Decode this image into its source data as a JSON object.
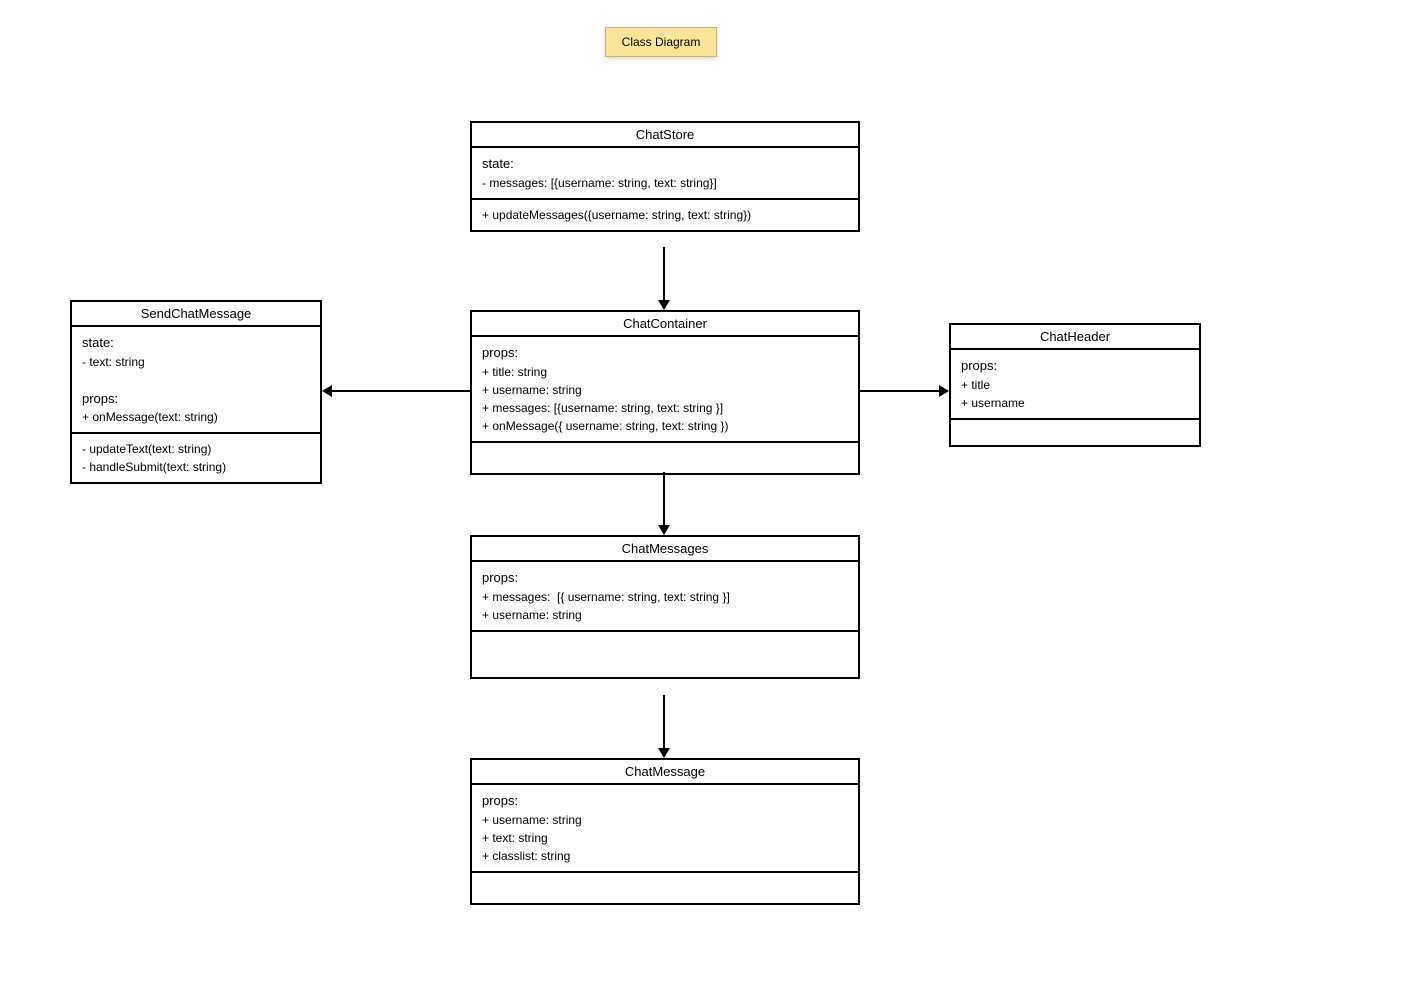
{
  "title": "Class Diagram",
  "classes": {
    "chatStore": {
      "name": "ChatStore",
      "stateLabel": "state:",
      "stateLines": "- messages: [{username: string, text: string}]",
      "methodLines": "+ updateMessages({username: string, text: string})"
    },
    "chatContainer": {
      "name": "ChatContainer",
      "propsLabel": "props:",
      "propsLines": "+ title: string\n+ username: string\n+ messages: [{username: string, text: string }]\n+ onMessage({ username: string, text: string })"
    },
    "sendChatMessage": {
      "name": "SendChatMessage",
      "stateLabel": "state:",
      "stateLines": "- text: string",
      "propsLabel": "props:",
      "propsLines": "+ onMessage(text: string)",
      "methodLines": "- updateText(text: string)\n- handleSubmit(text: string)"
    },
    "chatHeader": {
      "name": "ChatHeader",
      "propsLabel": "props:",
      "propsLines": "+ title\n+ username"
    },
    "chatMessages": {
      "name": "ChatMessages",
      "propsLabel": "props:",
      "propsLines": "+ messages:  [{ username: string, text: string }]\n+ username: string"
    },
    "chatMessage": {
      "name": "ChatMessage",
      "propsLabel": "props:",
      "propsLines": "+ username: string\n+ text: string\n+ classlist: string"
    }
  }
}
